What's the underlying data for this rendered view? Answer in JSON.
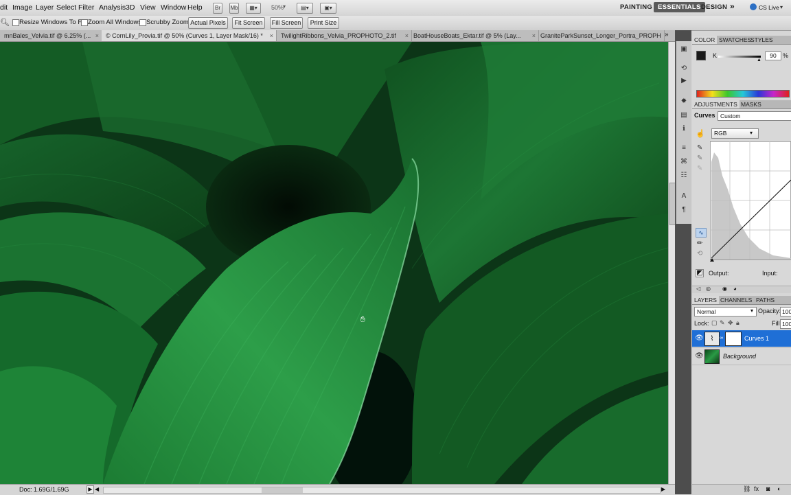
{
  "menubar": {
    "items": [
      "dit",
      "Image",
      "Layer",
      "Select",
      "Filter",
      "Analysis",
      "3D",
      "View",
      "Window",
      "Help"
    ],
    "zoom": "50%",
    "workspaces": [
      "PAINTING",
      "ESSENTIALS",
      "DESIGN"
    ],
    "more": "»",
    "cslive": "CS Live"
  },
  "options": {
    "resize_windows": "Resize Windows To Fit",
    "zoom_all": "Zoom All Windows",
    "scrubby_zoom": "Scrubby Zoom",
    "actual_pixels": "Actual Pixels",
    "fit_screen": "Fit Screen",
    "fill_screen": "Fill Screen",
    "print_size": "Print Size"
  },
  "tabs": [
    {
      "label": "mnBales_Velvia.tif @ 6.25% (...",
      "close": "×"
    },
    {
      "label": "© CornLily_Provia.tif @ 50% (Curves 1, Layer Mask/16) *",
      "close": "×"
    },
    {
      "label": "TwilightRibbons_Velvia_PROPHOTO_2.tif",
      "close": "×"
    },
    {
      "label": "BoatHouseBoats_Ektar.tif @ 5% (Lay...",
      "close": "×"
    },
    {
      "label": "GraniteParkSunset_Longer_Portra_PROPH",
      "close": ""
    }
  ],
  "tabs_more": "»",
  "status": {
    "doc": "Doc: 1.69G/1.69G",
    "arrow": "▶"
  },
  "color_panel": {
    "tabs": [
      "COLOR",
      "SWATCHES",
      "STYLES"
    ],
    "channel": "K",
    "value": "90",
    "unit": "%"
  },
  "adjustments_panel": {
    "tabs": [
      "ADJUSTMENTS",
      "MASKS"
    ],
    "title": "Curves",
    "preset": "Custom",
    "channel": "RGB",
    "output_label": "Output:",
    "input_label": "Input:"
  },
  "layers_panel": {
    "tabs": [
      "LAYERS",
      "CHANNELS",
      "PATHS"
    ],
    "blend_mode": "Normal",
    "opacity_label": "Opacity:",
    "opacity_value": "100",
    "lock_label": "Lock:",
    "fill_label": "Fill:",
    "fill_value": "100",
    "layers": [
      {
        "name": "Curves 1",
        "selected": true
      },
      {
        "name": "Background",
        "selected": false
      }
    ]
  },
  "colors": {
    "selection": "#1f6fd6",
    "leaf_dark": "#0b2b12",
    "leaf_mid": "#1d7a34",
    "leaf_light": "#3bb25a"
  }
}
